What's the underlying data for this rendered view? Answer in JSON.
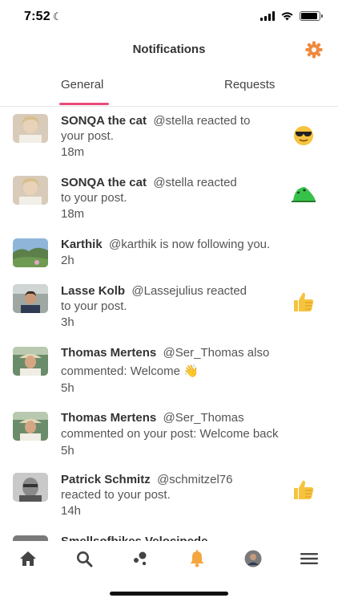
{
  "status_bar": {
    "time": "7:52",
    "battery_level": 0.9
  },
  "header": {
    "title": "Notifications"
  },
  "tabs": [
    {
      "label": "General",
      "active": true
    },
    {
      "label": "Requests",
      "active": false
    }
  ],
  "notifications": [
    {
      "name": "SONQA the cat",
      "handle": "@stella reacted to",
      "line2": "your post.",
      "time": "18m",
      "reaction": "sunglasses-emoji"
    },
    {
      "name": "SONQA the cat",
      "handle": "@stella reacted",
      "line2": "to your post.",
      "time": "18m",
      "reaction": "parrot-emoji"
    },
    {
      "name": "Karthik",
      "handle": "@karthik is now following you.",
      "line2": "",
      "time": "2h",
      "reaction": ""
    },
    {
      "name": "Lasse Kolb",
      "handle": "@Lassejulius reacted",
      "line2": "to your post.",
      "time": "3h",
      "reaction": "thumbs-up-emoji"
    },
    {
      "name": "Thomas Mertens",
      "handle": "@Ser_Thomas also",
      "line2": "commented: Welcome 👋",
      "time": "5h",
      "reaction": ""
    },
    {
      "name": "Thomas Mertens",
      "handle": "@Ser_Thomas",
      "line2": "commented on your post: Welcome back",
      "time": "5h",
      "reaction": ""
    },
    {
      "name": "Patrick Schmitz",
      "handle": "@schmitzel76",
      "line2": "reacted to your post.",
      "time": "14h",
      "reaction": "thumbs-up-emoji"
    },
    {
      "name": "Smellsofbikes Velocipede",
      "handle": "",
      "line2": "",
      "time": "",
      "reaction": ""
    }
  ],
  "bottom_nav": [
    "home-icon",
    "search-icon",
    "groups-icon",
    "bell-icon",
    "profile-avatar",
    "menu-icon"
  ],
  "colors": {
    "accent": "#ec4a7a",
    "gear": "#f08a3e",
    "bell": "#f4a640",
    "nav_icon": "#444444"
  }
}
